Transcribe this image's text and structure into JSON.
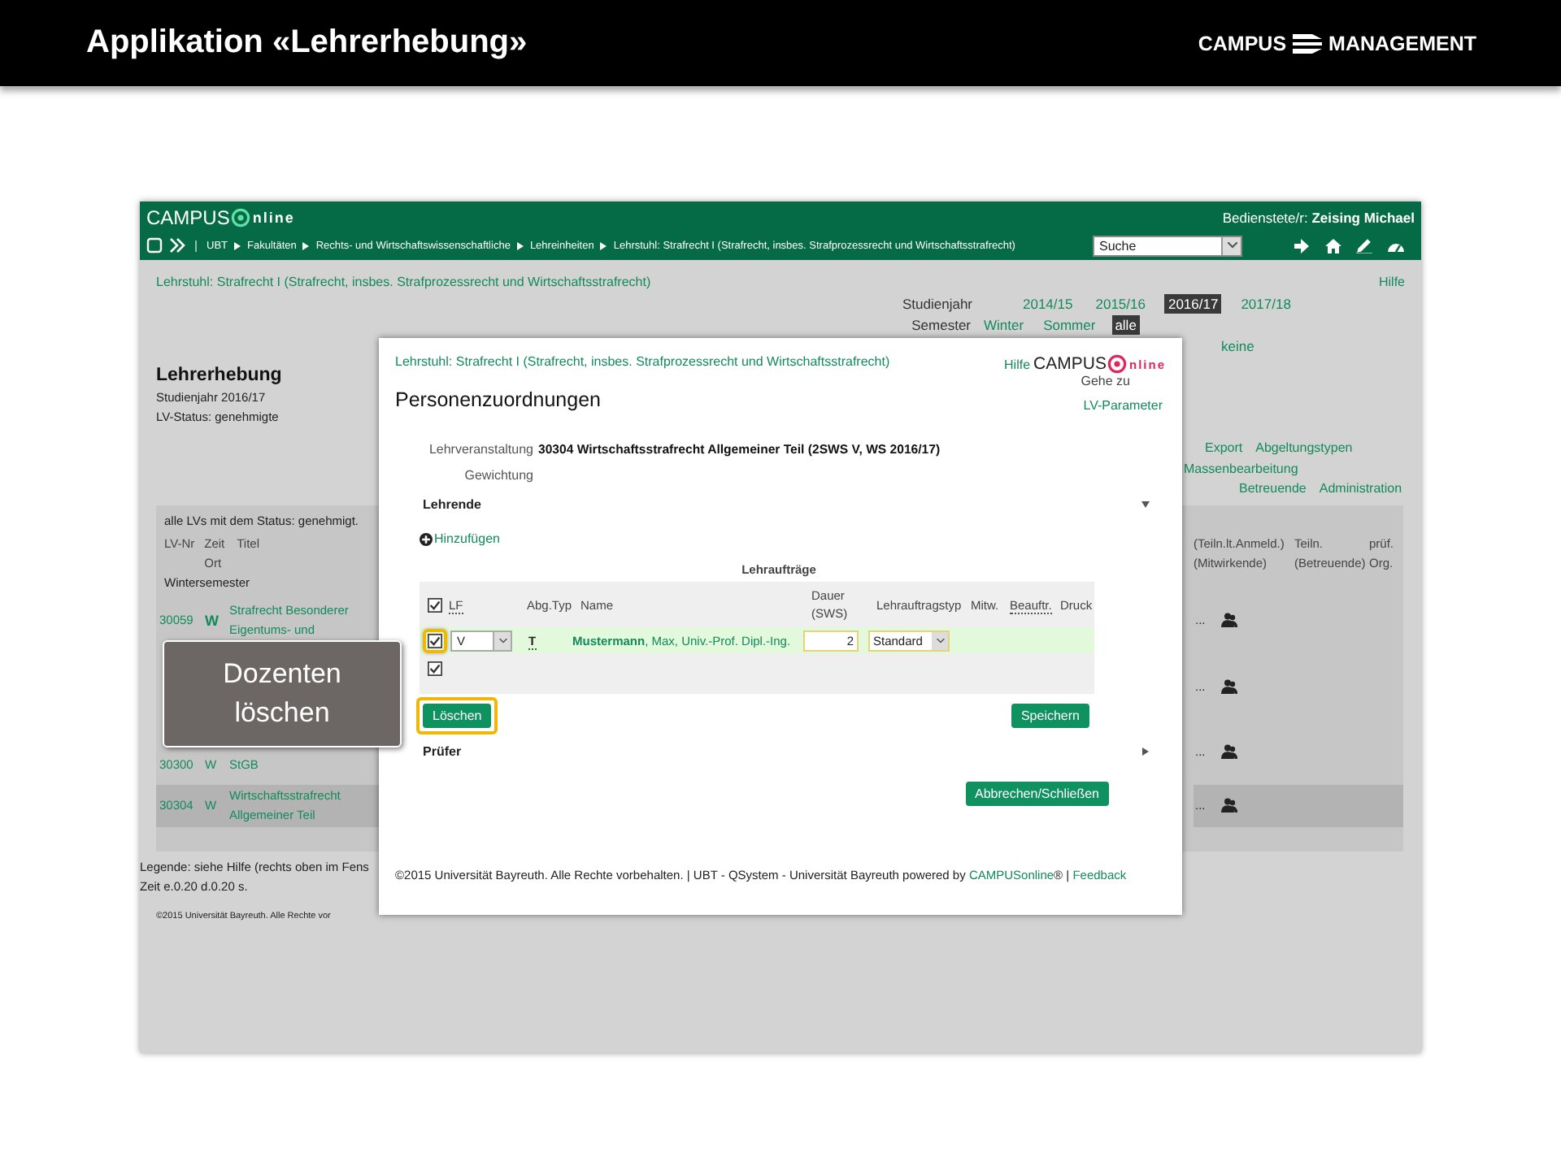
{
  "slide": {
    "title": "Applikation «Lehrerhebung»",
    "brand_left": "CAMPUS",
    "brand_right": "MANAGEMENT"
  },
  "app": {
    "logo_left": "CAMPUS",
    "logo_right": "nline",
    "breadcrumb": [
      "UBT",
      "Fakultäten",
      "Rechts- und Wirtschaftswissenschaftliche",
      "Lehreinheiten",
      "Lehrstuhl: Strafrecht I (Strafrecht, insbes. Strafprozessrecht und Wirtschaftsstrafrecht)"
    ],
    "user_label": "Bedienstete/r:",
    "user_name": "Zeising Michael",
    "search": {
      "value": "Suche"
    }
  },
  "page": {
    "unit": "Lehrstuhl: Strafrecht I (Strafrecht, insbes. Strafprozessrecht und Wirtschaftsstrafrecht)",
    "help": "Hilfe",
    "filters": [
      {
        "label": "Studienjahr",
        "options": [
          {
            "text": "2014/15",
            "selected": false
          },
          {
            "text": "2015/16",
            "selected": false
          },
          {
            "text": "2016/17",
            "selected": true
          },
          {
            "text": "2017/18",
            "selected": false
          }
        ]
      },
      {
        "label": "Semester",
        "options": [
          {
            "text": "Winter",
            "selected": false
          },
          {
            "text": "Sommer",
            "selected": false
          },
          {
            "text": "alle",
            "selected": true
          }
        ]
      },
      {
        "options": [
          {
            "text": "keine",
            "selected": false
          }
        ]
      }
    ],
    "title": "Lehrerhebung",
    "info": [
      "Studienjahr 2016/17",
      "LV-Status: genehmigte"
    ],
    "menu": [
      [
        "Export",
        "Abgeltungstypen"
      ],
      [
        "Massenbearbeitung"
      ],
      [
        "Betreuende",
        "Administration"
      ]
    ],
    "table": {
      "caption": "alle LVs mit dem Status: genehmigt.",
      "columns": [
        "LV-Nr",
        "Zeit Ort",
        "Titel"
      ],
      "columns_right": [
        "(Teiln.lt.Anmeld.) (Mitwirkende)",
        "Teiln. (Betreuende)",
        "prüf. Org."
      ],
      "group": "Wintersemester",
      "rows": [
        {
          "kind": "course",
          "number": "30059",
          "time": "W",
          "emphasized": true,
          "title_lines": [
            "Strafrecht Besonderer",
            "Eigentums- und"
          ],
          "tail": "...",
          "selected": false
        },
        {
          "kind": "covered",
          "tail": "...",
          "selected": false
        },
        {
          "kind": "course",
          "number": "30300",
          "time": "W",
          "emphasized": false,
          "title_lines": [
            "StGB"
          ],
          "tail": "...",
          "selected": false
        },
        {
          "kind": "course",
          "number": "30304",
          "time": "W",
          "emphasized": false,
          "title_lines": [
            "Wirtschaftsstrafrecht",
            "Allgemeiner Teil"
          ],
          "tail": "...",
          "selected": true
        }
      ]
    },
    "legend": "Legende: siehe Hilfe (rechts oben im Fens",
    "timing": "Zeit e.0.20 d.0.20 s.",
    "footer": "©2015 Universität Bayreuth. Alle Rechte vor"
  },
  "dialog": {
    "unit": "Lehrstuhl: Strafrecht I (Strafrecht, insbes. Strafprozessrecht und Wirtschaftsstrafrecht)",
    "help": "Hilfe",
    "logo_left": "CAMPUS",
    "logo_right": "nline",
    "goto": "Gehe zu",
    "goto_link": "LV-Parameter",
    "title": "Personenzuordnungen",
    "fields": [
      {
        "label": "Lehrveranstaltung",
        "value": "30304 Wirtschaftsstrafrecht Allgemeiner Teil (2SWS V, WS 2016/17)"
      },
      {
        "label": "Gewichtung"
      }
    ],
    "teachers": {
      "title": "Lehrende",
      "expanded": true,
      "add": "Hinzufügen",
      "caption": "Lehraufträge",
      "header_checked": true,
      "columns": [
        "LF",
        "Abg.Typ",
        "Name",
        "Dauer (SWS)",
        "Lehrauftragstyp",
        "Mitw.",
        "Beauftr.",
        "Druck"
      ],
      "rows": [
        {
          "kind": "assignment",
          "checked": true,
          "highlighted": true,
          "selected": true,
          "lf": "V",
          "abg_typ": "T",
          "name": "**Mustermann**, Max, Univ.-Prof. Dipl.-Ing.",
          "duration": "2",
          "type": "Standard"
        },
        {
          "kind": "blank",
          "checked": true,
          "highlighted": false,
          "selected": false
        }
      ],
      "delete": {
        "label": "Löschen",
        "highlighted": true
      },
      "save": {
        "label": "Speichern"
      }
    },
    "examiners": {
      "title": "Prüfer",
      "expanded": false
    },
    "close": "Abbrechen/Schließen",
    "footer": [
      {
        "kind": "text",
        "text": "©2015 Universität Bayreuth. Alle Rechte vorbehalten. | UBT - QSystem - Universität Bayreuth powered by"
      },
      {
        "kind": "link",
        "text": "CAMPUSonline"
      },
      {
        "kind": "text",
        "text": "® |"
      },
      {
        "kind": "link",
        "text": "Feedback"
      }
    ]
  },
  "callout": {
    "text": "Dozenten löschen"
  }
}
